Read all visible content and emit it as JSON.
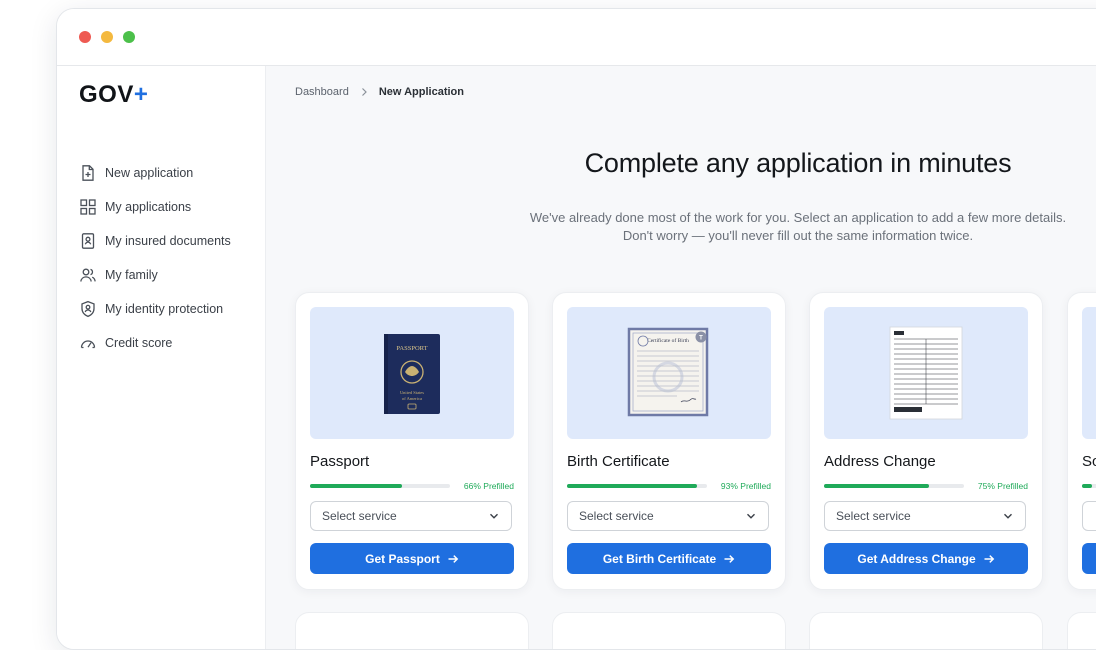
{
  "app": {
    "logo_text": "GOV",
    "logo_plus": "+"
  },
  "colors": {
    "accent": "#1f6fe0",
    "progress": "#1faa59",
    "thumb_bg": "#dfe9fb"
  },
  "sidebar": {
    "items": [
      {
        "label": "New application",
        "icon": "file-plus-icon"
      },
      {
        "label": "My applications",
        "icon": "grid-icon"
      },
      {
        "label": "My insured documents",
        "icon": "id-document-icon"
      },
      {
        "label": "My family",
        "icon": "users-icon"
      },
      {
        "label": "My identity protection",
        "icon": "shield-user-icon"
      },
      {
        "label": "Credit score",
        "icon": "gauge-icon"
      }
    ]
  },
  "breadcrumb": {
    "root": "Dashboard",
    "current": "New Application"
  },
  "hero": {
    "title": "Complete any application in minutes",
    "subtitle_line1": "We've already done most of the work for you. Select an application to add a few more  details.",
    "subtitle_line2": "Don't worry — you'll never fill out the same information twice."
  },
  "cards": [
    {
      "title": "Passport",
      "progress": 0.66,
      "progress_label": "66% Prefilled",
      "select_placeholder": "Select service",
      "button_label": "Get Passport",
      "passport_word": "PASSPORT",
      "passport_caption1": "United States",
      "passport_caption2": "of America"
    },
    {
      "title": "Birth Certificate",
      "progress": 0.93,
      "progress_label": "93% Prefilled",
      "select_placeholder": "Select service",
      "button_label": "Get Birth Certificate",
      "cert_heading": "Certificate of Birth",
      "cert_badge": "T"
    },
    {
      "title": "Address Change",
      "progress": 0.75,
      "progress_label": "75% Prefilled",
      "select_placeholder": "Select service",
      "button_label": "Get Address Change"
    },
    {
      "title": "So"
    }
  ]
}
